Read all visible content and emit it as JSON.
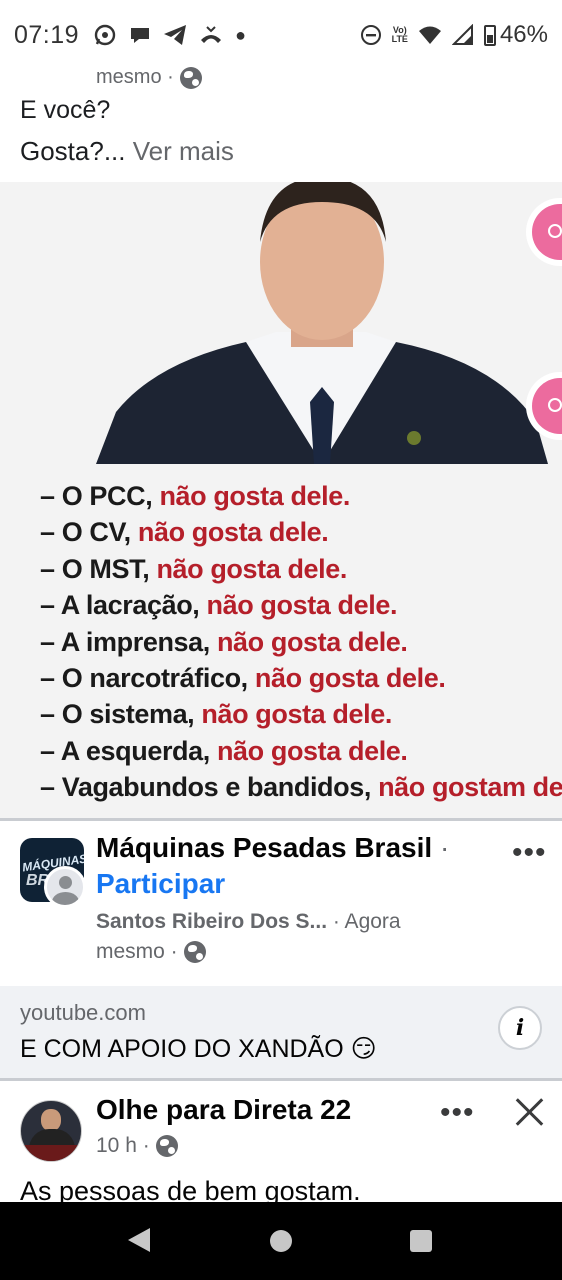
{
  "status_bar": {
    "time": "07:19",
    "lte_top": "Vo)",
    "lte_bottom": "LTE",
    "battery": "46%"
  },
  "top_post": {
    "meta_suffix": "mesmo ·",
    "text_cut": "E você?",
    "text": "Gosta?...",
    "see_more": "Ver mais",
    "image_list": [
      {
        "prefix": "– O PCC, ",
        "suffix": "não gosta dele."
      },
      {
        "prefix": "– O CV, ",
        "suffix": "não gosta dele."
      },
      {
        "prefix": "– O MST, ",
        "suffix": "não gosta dele."
      },
      {
        "prefix": "– A lacração, ",
        "suffix": "não gosta dele."
      },
      {
        "prefix": "– A imprensa, ",
        "suffix": "não gosta dele."
      },
      {
        "prefix": "– O narcotráfico, ",
        "suffix": "não gosta dele."
      },
      {
        "prefix": "– O sistema, ",
        "suffix": "não gosta dele."
      },
      {
        "prefix": "– A esquerda, ",
        "suffix": "não gosta dele."
      },
      {
        "prefix": "– Vagabundos e bandidos, ",
        "suffix": "não gostam dele."
      }
    ]
  },
  "group_post": {
    "group_name": "Máquinas Pesadas Brasil",
    "separator": "·",
    "join_label": "Participar",
    "author": "Santos Ribeiro Dos S...",
    "time_part1": "· Agora",
    "time_part2": "mesmo ·",
    "more_label": "•••",
    "avatar_text_1": "MÁQUINAS",
    "avatar_text_2": "BR",
    "link": {
      "domain": "youtube.com",
      "title": "E COM APOIO DO XANDÃO 😏",
      "info_label": "i"
    }
  },
  "next_post": {
    "page_name": "Olhe para Direta 22",
    "time": "10 h ·",
    "more_label": "•••",
    "text": "As pessoas de bem gostam."
  },
  "colors": {
    "link_blue": "#1877f2",
    "highlight_red": "#b51f2a",
    "side_button_pink": "#ec6b9e"
  }
}
